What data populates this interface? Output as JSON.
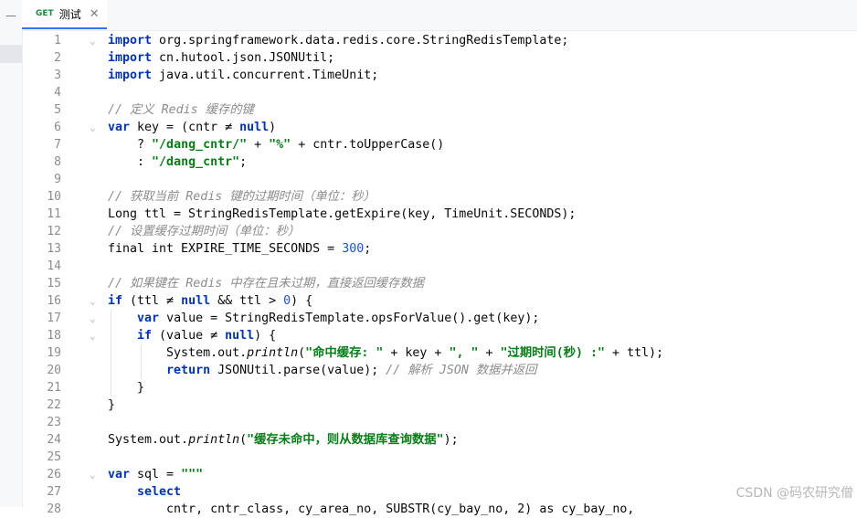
{
  "left_strip": {
    "collapse_glyph": "—"
  },
  "tab": {
    "method": "GET",
    "title": "测试",
    "close_glyph": "✕"
  },
  "lines": [
    [
      [
        "kw",
        "import"
      ],
      [
        "t",
        " org.springframework.data.redis.core.StringRedisTemplate;"
      ]
    ],
    [
      [
        "kw",
        "import"
      ],
      [
        "t",
        " cn.hutool.json.JSONUtil;"
      ]
    ],
    [
      [
        "kw",
        "import"
      ],
      [
        "t",
        " java.util.concurrent.TimeUnit;"
      ]
    ],
    [],
    [
      [
        "cm",
        "// 定义 Redis 缓存的键"
      ]
    ],
    [
      [
        "kw",
        "var"
      ],
      [
        "t",
        " key = (cntr ≠ "
      ],
      [
        "kw",
        "null"
      ],
      [
        "t",
        ")"
      ]
    ],
    [
      [
        "t",
        "    ? "
      ],
      [
        "str",
        "\"/dang_cntr/\""
      ],
      [
        "t",
        " + "
      ],
      [
        "str",
        "\"%\""
      ],
      [
        "t",
        " + cntr.toUpperCase()"
      ]
    ],
    [
      [
        "t",
        "    : "
      ],
      [
        "str",
        "\"/dang_cntr\""
      ],
      [
        "t",
        ";"
      ]
    ],
    [],
    [
      [
        "cm",
        "// 获取当前 Redis 键的过期时间（单位：秒）"
      ]
    ],
    [
      [
        "t",
        "Long ttl = StringRedisTemplate.getExpire(key, TimeUnit.SECONDS);"
      ]
    ],
    [
      [
        "cm",
        "// 设置缓存过期时间（单位：秒）"
      ]
    ],
    [
      [
        "t",
        "final int EXPIRE_TIME_SECONDS = "
      ],
      [
        "num",
        "300"
      ],
      [
        "t",
        ";"
      ]
    ],
    [],
    [
      [
        "cm",
        "// 如果键在 Redis 中存在且未过期，直接返回缓存数据"
      ]
    ],
    [
      [
        "kw",
        "if"
      ],
      [
        "t",
        " (ttl ≠ "
      ],
      [
        "kw",
        "null"
      ],
      [
        "t",
        " && ttl > "
      ],
      [
        "num",
        "0"
      ],
      [
        "t",
        ") {"
      ]
    ],
    [
      [
        "t",
        "    "
      ],
      [
        "kw",
        "var"
      ],
      [
        "t",
        " value = StringRedisTemplate.opsForValue().get(key);"
      ]
    ],
    [
      [
        "t",
        "    "
      ],
      [
        "kw",
        "if"
      ],
      [
        "t",
        " (value ≠ "
      ],
      [
        "kw",
        "null"
      ],
      [
        "t",
        ") {"
      ]
    ],
    [
      [
        "t",
        "        System.out."
      ],
      [
        "it",
        "println"
      ],
      [
        "t",
        "("
      ],
      [
        "str",
        "\"命中缓存: \""
      ],
      [
        "t",
        " + key + "
      ],
      [
        "str",
        "\", \""
      ],
      [
        "t",
        " + "
      ],
      [
        "str",
        "\"过期时间(秒) :\""
      ],
      [
        "t",
        " + ttl);"
      ]
    ],
    [
      [
        "t",
        "        "
      ],
      [
        "kw",
        "return"
      ],
      [
        "t",
        " JSONUtil.parse(value); "
      ],
      [
        "cm",
        "// 解析 JSON 数据并返回"
      ]
    ],
    [
      [
        "t",
        "    }"
      ]
    ],
    [
      [
        "t",
        "}"
      ]
    ],
    [],
    [
      [
        "t",
        "System.out."
      ],
      [
        "it",
        "println"
      ],
      [
        "t",
        "("
      ],
      [
        "str",
        "\"缓存未命中，则从数据库查询数据\""
      ],
      [
        "t",
        ");"
      ]
    ],
    [],
    [
      [
        "kw",
        "var"
      ],
      [
        "t",
        " sql = "
      ],
      [
        "str",
        "\"\"\""
      ]
    ],
    [
      [
        "t",
        "    "
      ],
      [
        "kw",
        "select"
      ]
    ],
    [
      [
        "t",
        "        cntr, cntr_class, cy_area_no, SUBSTR(cy_bay_no, 2) as cy_bay_no,"
      ]
    ]
  ],
  "fold_lines": [
    1,
    6,
    16,
    17,
    18,
    26
  ],
  "watermark": "CSDN @码农研究僧"
}
